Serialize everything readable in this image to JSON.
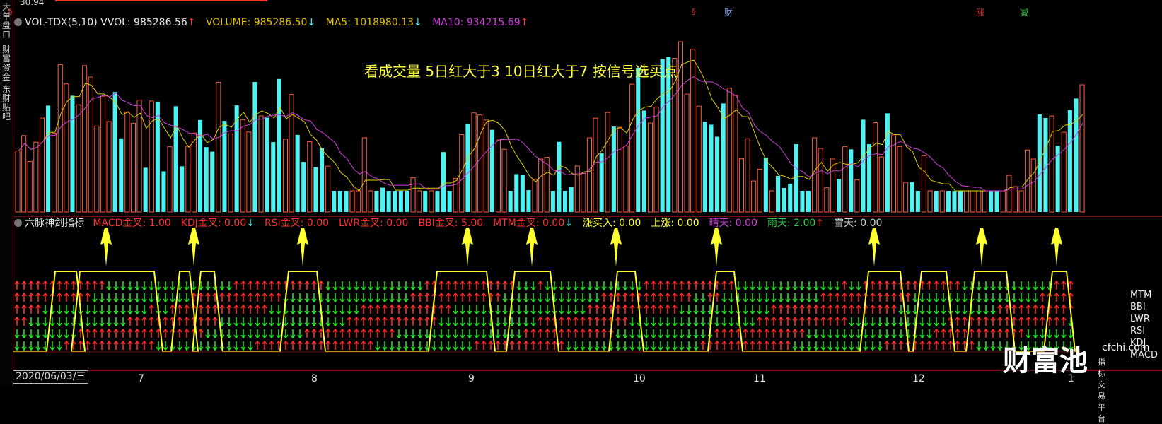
{
  "sidebar": {
    "tabs": [
      "大单盘口",
      "财富资金",
      "东财贴吧"
    ]
  },
  "top_strip": {
    "price_left": "30.94",
    "marks": [
      {
        "text": "§",
        "color": "#e83030"
      },
      {
        "text": "§",
        "color": "#e83030"
      },
      {
        "text": "财",
        "color": "#7fb0ff"
      },
      {
        "text": "涨",
        "color": "#e83030"
      },
      {
        "text": "减",
        "color": "#2fd04a"
      }
    ]
  },
  "volume_panel": {
    "name": "VOL-TDX(5,10)",
    "vvol": "VVOL: 985286.56",
    "vvol_arrow": "↑",
    "volume": "VOLUME: 985286.50",
    "volume_arrow": "↓",
    "ma5": "MA5: 1018980.13",
    "ma5_arrow": "↓",
    "ma10": "MA10: 934215.69",
    "ma10_arrow": "↑",
    "note": "看成交量 5日红大于3 10日红大于7 按信号选买点",
    "colors": {
      "up": "#ff5a3c",
      "down": "#4ef2f2",
      "ma5": "#e0d000",
      "ma10": "#d040e0"
    }
  },
  "signal_panel": {
    "name": "六脉神剑指标",
    "items": [
      {
        "text": "MACD金叉: 1.00",
        "arrow": "",
        "color": "#ff3030"
      },
      {
        "text": "KDJ金叉: 0.00",
        "arrow": "↓",
        "color": "#ff3030"
      },
      {
        "text": "RSI金叉: 0.00",
        "arrow": "",
        "color": "#ff3030"
      },
      {
        "text": "LWR金叉: 0.00",
        "arrow": "",
        "color": "#ff3030"
      },
      {
        "text": "BBI金叉: 5.00",
        "arrow": "",
        "color": "#ff3030"
      },
      {
        "text": "MTM金叉: 0.00",
        "arrow": "↓",
        "color": "#ff3030"
      },
      {
        "text": "涨买入: 0.00",
        "arrow": "",
        "color": "#ffff30"
      },
      {
        "text": "上涨: 0.00",
        "arrow": "",
        "color": "#ffff30"
      },
      {
        "text": "晴天: 0.00",
        "arrow": "",
        "color": "#d040e0"
      },
      {
        "text": "雨天: 2.00",
        "arrow": "↑",
        "color": "#2fd04a"
      },
      {
        "text": "雪天: 0.00",
        "arrow": "",
        "color": "#d0d0d0"
      }
    ],
    "row_legend": [
      "MTM",
      "BBI",
      "LWR",
      "RSI",
      "KDJ",
      "MACD"
    ]
  },
  "x_axis": {
    "date_label": "2020/06/03/三",
    "months": [
      "7",
      "8",
      "9",
      "10",
      "11",
      "12",
      "1"
    ]
  },
  "watermark": {
    "brand": "财富池",
    "site": "cfchi.com",
    "tagline": "指标交易平台"
  }
}
